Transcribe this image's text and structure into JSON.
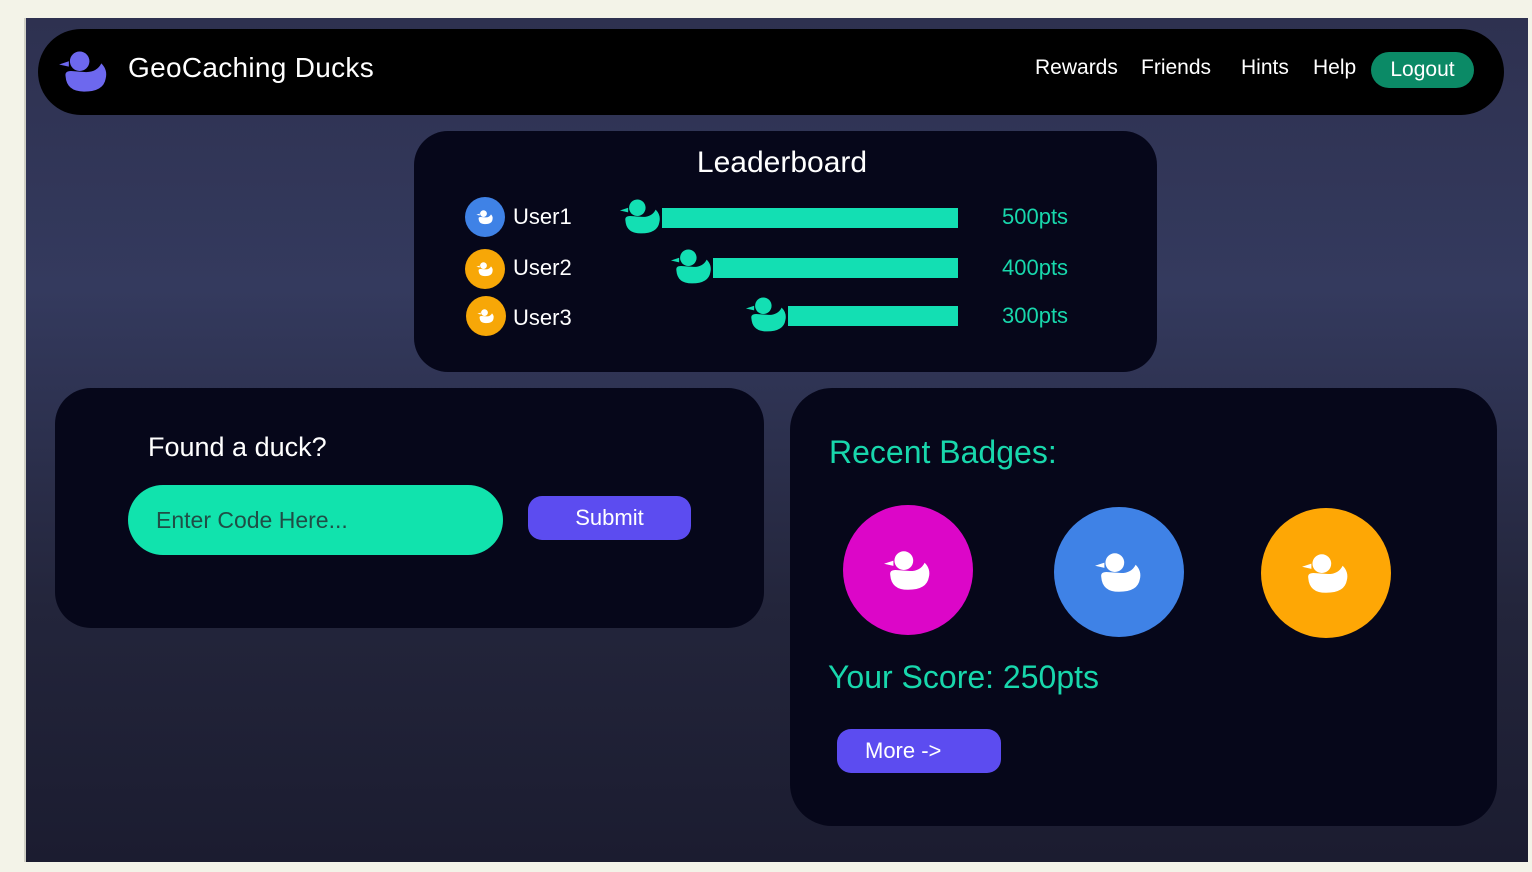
{
  "app": {
    "title": "GeoCaching Ducks",
    "icon": "duck-icon",
    "accent": "#5c4cf0",
    "teal": "#13dfb3"
  },
  "nav": {
    "items": [
      {
        "label": "Rewards"
      },
      {
        "label": "Friends"
      },
      {
        "label": "Hints"
      },
      {
        "label": "Help"
      }
    ],
    "logout_label": "Logout"
  },
  "leaderboard": {
    "title": "Leaderboard",
    "entries": [
      {
        "user": "User1",
        "points": 500,
        "points_label": "500pts",
        "avatar_color": "#3f82e6",
        "avatar_icon": "duck-icon"
      },
      {
        "user": "User2",
        "points": 400,
        "points_label": "400pts",
        "avatar_color": "#f7a707",
        "avatar_icon": "duck-icon"
      },
      {
        "user": "User3",
        "points": 300,
        "points_label": "300pts",
        "avatar_color": "#f7a707",
        "avatar_icon": "duck-icon"
      }
    ]
  },
  "found": {
    "title": "Found a duck?",
    "input_placeholder": "Enter Code Here...",
    "input_value": "",
    "submit_label": "Submit"
  },
  "badges": {
    "title": "Recent Badges:",
    "items": [
      {
        "color": "#dc06c8",
        "icon": "duck-icon"
      },
      {
        "color": "#3f82e6",
        "icon": "duck-icon"
      },
      {
        "color": "#fea705",
        "icon": "duck-icon"
      }
    ],
    "score_label": "Your Score: 250pts",
    "more_label": "More ->"
  }
}
